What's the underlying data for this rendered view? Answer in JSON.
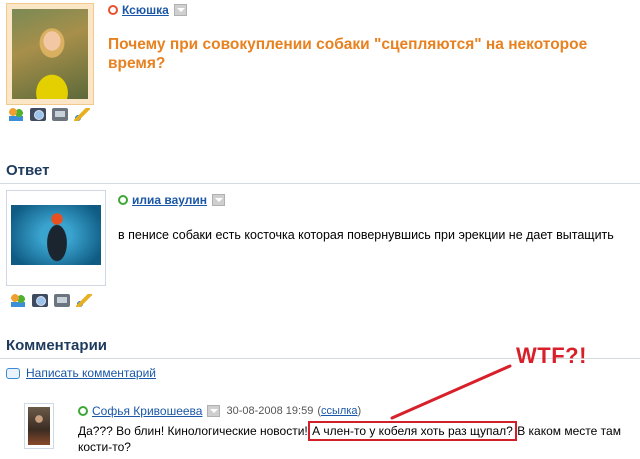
{
  "question": {
    "author": "Ксюшка",
    "title": "Почему при совокуплении собаки \"сцепляются\" на некоторое время?",
    "author_actions": [
      "users-icon",
      "photo-icon",
      "video-icon",
      "edit-icon"
    ]
  },
  "answer": {
    "section_title": "Ответ",
    "author": "илиа ваулин",
    "text": "в пенисе собаки есть косточка которая повернувшись при эрекции не дает вытащить",
    "author_actions": [
      "users-icon",
      "photo-icon",
      "video-icon",
      "edit-icon"
    ]
  },
  "comments": {
    "section_title": "Комментарии",
    "write_label": "Написать комментарий",
    "items": [
      {
        "author": "Софья Кривошеева",
        "date": "30-08-2008 19:59",
        "link_label": "ссылка",
        "text_before": "Да??? Во блин! Кинологические новости! ",
        "text_highlight": "А член-то у кобеля хоть раз щупал?",
        "text_after": " В каком месте там кости-то?"
      }
    ]
  },
  "annotation": {
    "label": "WTF?!",
    "color": "#d8202a"
  },
  "colors": {
    "question_title": "#e8811f",
    "link": "#1a57a6",
    "section_title": "#1e3a5c"
  }
}
